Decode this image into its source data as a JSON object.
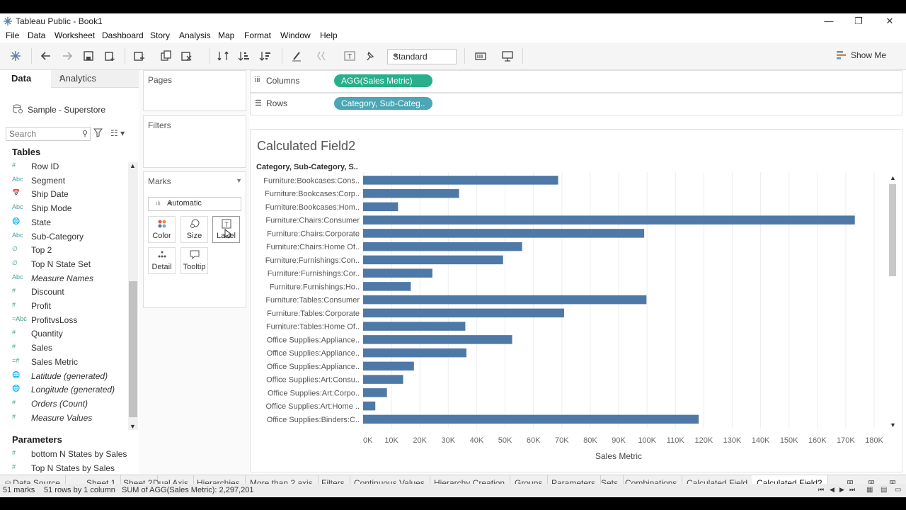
{
  "window": {
    "title": "Tableau Public - Book1",
    "minimize": "—",
    "restore": "❐",
    "close": "✕"
  },
  "menu": [
    "File",
    "Data",
    "Worksheet",
    "Dashboard",
    "Story",
    "Analysis",
    "Map",
    "Format",
    "Window",
    "Help"
  ],
  "toolbar": {
    "fit_select": "Standard",
    "show_me": "Show Me"
  },
  "data_pane": {
    "tab_data": "Data",
    "tab_analytics": "Analytics",
    "data_source": "Sample - Superstore",
    "search_placeholder": "Search",
    "tables_header": "Tables",
    "dimensions": [
      {
        "icon": "#",
        "label": "Row ID",
        "italic": false
      },
      {
        "icon": "Abc",
        "label": "Segment",
        "italic": false
      },
      {
        "icon": "📅",
        "label": "Ship Date",
        "italic": false
      },
      {
        "icon": "Abc",
        "label": "Ship Mode",
        "italic": false
      },
      {
        "icon": "🌐",
        "label": "State",
        "italic": false
      },
      {
        "icon": "Abc",
        "label": "Sub-Category",
        "italic": false
      },
      {
        "icon": "∅",
        "label": "Top 2",
        "italic": false
      },
      {
        "icon": "∅",
        "label": "Top N State Set",
        "italic": false
      },
      {
        "icon": "Abc",
        "label": "Measure Names",
        "italic": true
      }
    ],
    "measures": [
      {
        "icon": "#",
        "label": "Discount",
        "italic": false
      },
      {
        "icon": "#",
        "label": "Profit",
        "italic": false
      },
      {
        "icon": "=Abc",
        "label": "ProfitvsLoss",
        "italic": false
      },
      {
        "icon": "#",
        "label": "Quantity",
        "italic": false
      },
      {
        "icon": "#",
        "label": "Sales",
        "italic": false
      },
      {
        "icon": "=#",
        "label": "Sales Metric",
        "italic": false
      },
      {
        "icon": "🌐",
        "label": "Latitude (generated)",
        "italic": true
      },
      {
        "icon": "🌐",
        "label": "Longitude (generated)",
        "italic": true
      },
      {
        "icon": "#",
        "label": "Orders (Count)",
        "italic": true
      },
      {
        "icon": "#",
        "label": "Measure Values",
        "italic": true
      }
    ],
    "parameters_header": "Parameters",
    "parameters": [
      {
        "icon": "#",
        "label": "bottom N States by Sales"
      },
      {
        "icon": "#",
        "label": "Top N States by Sales"
      }
    ]
  },
  "cards": {
    "pages": "Pages",
    "filters": "Filters",
    "marks": "Marks",
    "mark_type": "Automatic",
    "mark_buttons": [
      {
        "label": "Color",
        "icon": "color-icon"
      },
      {
        "label": "Size",
        "icon": "size-icon"
      },
      {
        "label": "Label",
        "icon": "label-icon"
      },
      {
        "label": "Detail",
        "icon": "detail-icon"
      },
      {
        "label": "Tooltip",
        "icon": "tooltip-icon"
      }
    ]
  },
  "shelves": {
    "columns_label": "Columns",
    "columns_pill": "AGG(Sales Metric)",
    "rows_label": "Rows",
    "rows_pill": "Category, Sub-Categ.."
  },
  "view": {
    "title": "Calculated Field2",
    "row_header": "Category, Sub-Category, S..",
    "x_axis_label": "Sales Metric"
  },
  "chart_data": {
    "type": "bar",
    "orientation": "horizontal",
    "bar_color": "#4e79a7",
    "categories": [
      "Furniture:Bookcases:Cons..",
      "Furniture:Bookcases:Corp..",
      "Furniture:Bookcases:Hom..",
      "Furniture:Chairs:Consumer",
      "Furniture:Chairs:Corporate",
      "Furniture:Chairs:Home Of..",
      "Furniture:Furnishings:Con..",
      "Furniture:Furnishings:Cor..",
      "Furniture:Furnishings:Ho..",
      "Furniture:Tables:Consumer",
      "Furniture:Tables:Corporate",
      "Furniture:Tables:Home Of..",
      "Office Supplies:Appliance..",
      "Office Supplies:Appliance..",
      "Office Supplies:Appliance..",
      "Office Supplies:Art:Consu..",
      "Office Supplies:Art:Corpo..",
      "Office Supplies:Art:Home ..",
      "Office Supplies:Binders:C.."
    ],
    "values": [
      68700,
      33800,
      12300,
      173200,
      99000,
      56000,
      49300,
      24400,
      16800,
      99800,
      70800,
      36000,
      52500,
      36400,
      17900,
      14100,
      8400,
      4300,
      118200
    ],
    "xlim": [
      0,
      180000
    ],
    "x_ticks": [
      "0K",
      "10K",
      "20K",
      "30K",
      "40K",
      "50K",
      "60K",
      "70K",
      "80K",
      "90K",
      "100K",
      "110K",
      "120K",
      "130K",
      "140K",
      "150K",
      "160K",
      "170K",
      "180K"
    ],
    "xlabel": "Sales Metric",
    "grid": true
  },
  "sheet_tabs": [
    {
      "label": "Data Source",
      "icon": true
    },
    {
      "label": "Sheet 1"
    },
    {
      "label": "Sheet 2"
    },
    {
      "label": "Dual Axis"
    },
    {
      "label": "Hierarchies"
    },
    {
      "label": "More than 2 axis"
    },
    {
      "label": "Filters"
    },
    {
      "label": "Continuous Values"
    },
    {
      "label": "Hierarchy Creation"
    },
    {
      "label": "Groups"
    },
    {
      "label": "Parameters"
    },
    {
      "label": "Sets"
    },
    {
      "label": "Combinations"
    },
    {
      "label": "Calculated Field"
    },
    {
      "label": "Calculated Field2",
      "active": true
    }
  ],
  "status": {
    "marks": "51 marks",
    "rows": "51 rows by 1 column",
    "sum": "SUM of AGG(Sales Metric): 2,297,201"
  }
}
